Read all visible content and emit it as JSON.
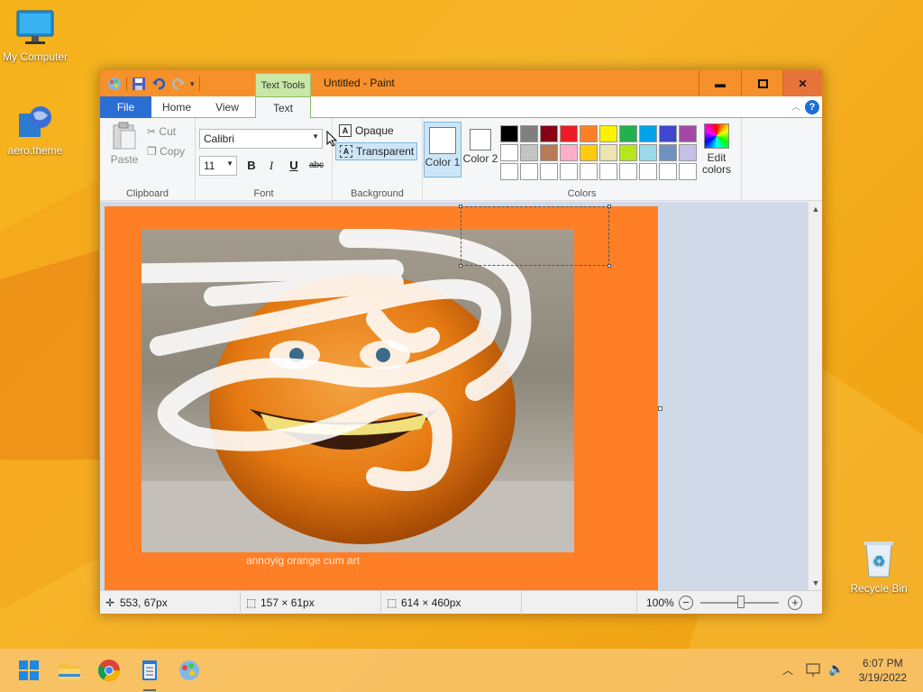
{
  "desktop": {
    "icons": [
      {
        "label": "My Computer"
      },
      {
        "label": "aero.theme"
      },
      {
        "label": "Recycle Bin"
      }
    ]
  },
  "window": {
    "title": "Untitled - Paint",
    "contextual_tab": "Text Tools",
    "controls": {
      "minimize": "minimize-icon",
      "maximize": "maximize-icon",
      "close": "close-icon"
    }
  },
  "tabs": [
    {
      "label": "File"
    },
    {
      "label": "Home"
    },
    {
      "label": "View"
    },
    {
      "label": "Text"
    }
  ],
  "ribbon": {
    "clipboard": {
      "paste": "Paste",
      "cut": "Cut",
      "copy": "Copy",
      "label": "Clipboard"
    },
    "font": {
      "family": "Calibri",
      "size": "11",
      "bold": "B",
      "italic": "I",
      "underline": "U",
      "strike": "abc",
      "label": "Font"
    },
    "background": {
      "opaque": "Opaque",
      "transparent": "Transparent",
      "label": "Background"
    },
    "colors": {
      "color1": "Color 1",
      "color2": "Color 2",
      "edit": "Edit colors",
      "label": "Colors",
      "palette": [
        "#000000",
        "#7f7f7f",
        "#880015",
        "#ed1c24",
        "#ff7f27",
        "#fff200",
        "#22b14c",
        "#00a2e8",
        "#3f48cc",
        "#a349a4",
        "#ffffff",
        "#c3c3c3",
        "#b97a57",
        "#ffaec9",
        "#ffc90e",
        "#efe4b0",
        "#b5e61d",
        "#99d9ea",
        "#7092be",
        "#c8bfe7",
        "#ffffff",
        "#ffffff",
        "#ffffff",
        "#ffffff",
        "#ffffff",
        "#ffffff",
        "#ffffff",
        "#ffffff",
        "#ffffff",
        "#ffffff"
      ]
    }
  },
  "canvas": {
    "background": "#ff7f27",
    "caption": "annoyig orange cum art"
  },
  "status": {
    "cursor": "553, 67px",
    "selection": "157 × 61px",
    "image_size": "614 × 460px",
    "zoom": "100%"
  },
  "taskbar": {
    "time": "6:07 PM",
    "date": "3/19/2022"
  }
}
